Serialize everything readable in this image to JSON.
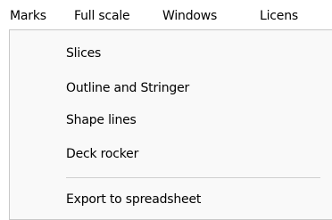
{
  "menubar": {
    "items": [
      {
        "label": "Marks"
      },
      {
        "label": "Full scale"
      },
      {
        "label": "Windows"
      },
      {
        "label": "Licens"
      }
    ]
  },
  "menu": {
    "items": [
      {
        "label": "Slices"
      },
      {
        "label": "Outline and Stringer"
      },
      {
        "label": "Shape lines"
      },
      {
        "label": "Deck rocker"
      },
      {
        "label": "Export to spreadsheet"
      }
    ]
  }
}
